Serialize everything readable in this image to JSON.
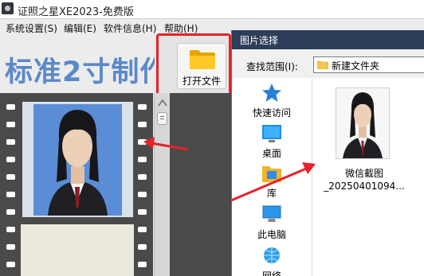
{
  "app": {
    "title": "证照之星XE2023-免费版",
    "icon": "camera-app-icon"
  },
  "menubar": {
    "items": [
      {
        "label": "系统设置(S)"
      },
      {
        "label": "编辑(E)"
      },
      {
        "label": "软件信息(H)"
      },
      {
        "label": "帮助(H)"
      }
    ]
  },
  "banner": {
    "title": "标准2寸制作",
    "color": "#5b88c8"
  },
  "toolbar": {
    "open_label": "打开文件",
    "open_icon": "folder-icon",
    "highlight_color": "#e8212a"
  },
  "dialog": {
    "title": "图片选择",
    "lookin_label": "查找范围(I):",
    "lookin_value": "新建文件夹",
    "places": [
      {
        "label": "快速访问",
        "icon": "star-pin-icon"
      },
      {
        "label": "桌面",
        "icon": "desktop-icon"
      },
      {
        "label": "库",
        "icon": "library-icon"
      },
      {
        "label": "此电脑",
        "icon": "computer-icon"
      },
      {
        "label": "网络",
        "icon": "network-icon"
      }
    ],
    "files": [
      {
        "name_line1": "微信截图",
        "name_line2": "_20250401094..."
      }
    ]
  },
  "colors": {
    "filmstrip": "#4a4a4a",
    "photo_background": "#5a8dd6",
    "dialog_titlebar": "#2c3e58",
    "arrow": "#e8212a"
  }
}
